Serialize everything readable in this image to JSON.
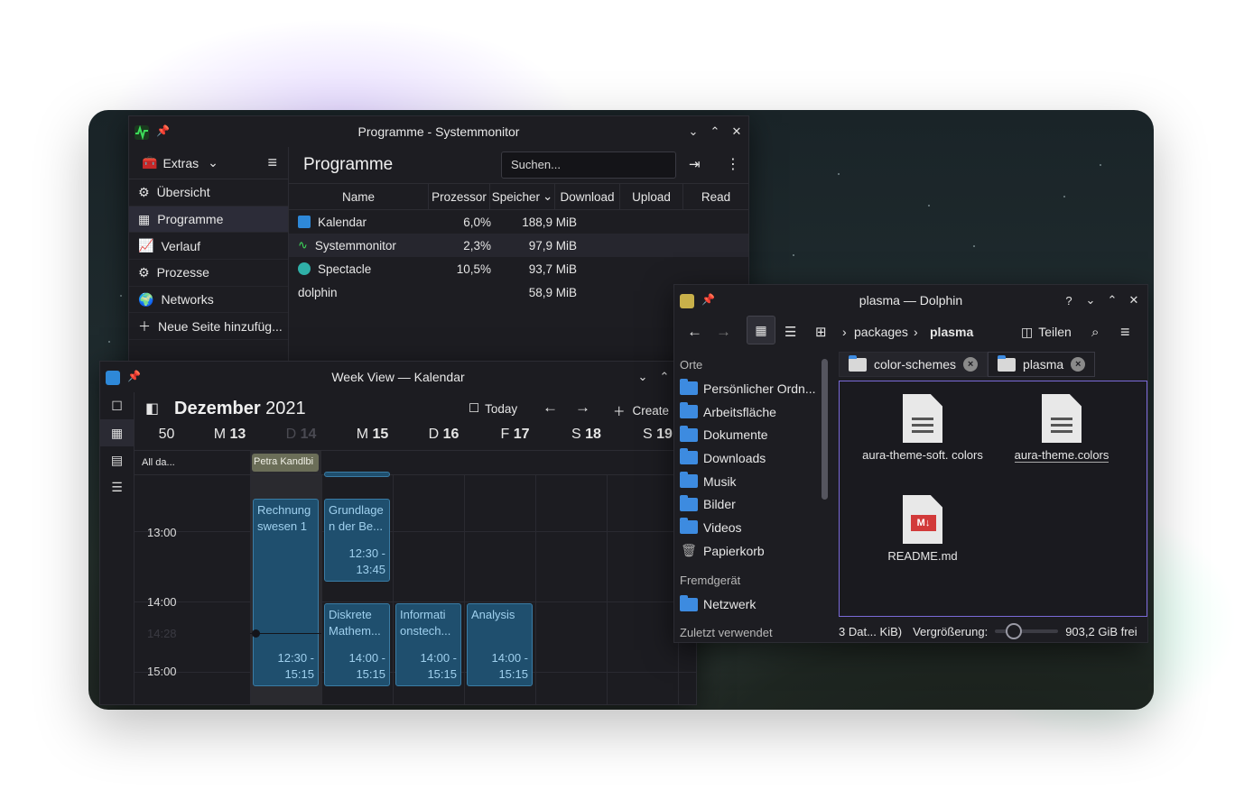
{
  "sysmon": {
    "title": "Programme - Systemmonitor",
    "extras_label": "Extras",
    "sidebar": [
      {
        "label": "Übersicht",
        "icon": "overview-icon"
      },
      {
        "label": "Programme",
        "icon": "apps-grid-icon",
        "active": true
      },
      {
        "label": "Verlauf",
        "icon": "history-chart-icon"
      },
      {
        "label": "Prozesse",
        "icon": "processes-icon"
      },
      {
        "label": "Networks",
        "icon": "globe-icon"
      },
      {
        "label": "Neue Seite hinzufüg...",
        "icon": "plus-icon"
      }
    ],
    "page_title": "Programme",
    "search_placeholder": "Suchen...",
    "columns": [
      "Name",
      "Prozessor",
      "Speicher",
      "Download",
      "Upload",
      "Read"
    ],
    "rows": [
      {
        "name": "Kalendar",
        "cpu": "6,0%",
        "mem": "188,9 MiB"
      },
      {
        "name": "Systemmonitor",
        "cpu": "2,3%",
        "mem": "97,9 MiB"
      },
      {
        "name": "Spectacle",
        "cpu": "10,5%",
        "mem": "93,7 MiB"
      },
      {
        "name": "dolphin",
        "cpu": "",
        "mem": "58,9 MiB"
      }
    ]
  },
  "kalendar": {
    "title": "Week View — Kalendar",
    "month": "Dezember",
    "year": "2021",
    "today_label": "Today",
    "create_label": "Create",
    "week_label": "50",
    "days": [
      {
        "wd": "M",
        "d": "13"
      },
      {
        "wd": "D",
        "d": "14"
      },
      {
        "wd": "M",
        "d": "15"
      },
      {
        "wd": "D",
        "d": "16"
      },
      {
        "wd": "F",
        "d": "17"
      },
      {
        "wd": "S",
        "d": "18"
      },
      {
        "wd": "S",
        "d": "19"
      }
    ],
    "allday_label": "All da...",
    "allday_event": "Petra Kandlbi",
    "times": [
      "13:00",
      "14:00",
      "14:28",
      "15:00"
    ],
    "events": [
      {
        "title": "Rechnung swesen 1",
        "time": "12:30 - 15:15"
      },
      {
        "title": "Grundlage n der Be...",
        "time": "12:30 - 13:45"
      },
      {
        "title": "Diskrete Mathem...",
        "time": "14:00 - 15:15"
      },
      {
        "title": "Informati onstech...",
        "time": "14:00 - 15:15"
      },
      {
        "title": "Analysis",
        "time": "14:00 - 15:15"
      }
    ]
  },
  "dolphin": {
    "title": "plasma — Dolphin",
    "breadcrumb": [
      "packages",
      "plasma"
    ],
    "split_label": "Teilen",
    "places_header": "Orte",
    "places": [
      "Persönlicher Ordn...",
      "Arbeitsfläche",
      "Dokumente",
      "Downloads",
      "Musik",
      "Bilder",
      "Videos",
      "Papierkorb"
    ],
    "devices_header": "Fremdgerät",
    "network": "Netzwerk",
    "recent_header": "Zuletzt verwendet",
    "tabs": [
      "color-schemes",
      "plasma"
    ],
    "files": [
      {
        "name": "aura-theme-soft. colors",
        "icon": "text-file-icon"
      },
      {
        "name": "aura-theme.colors",
        "icon": "text-file-icon"
      },
      {
        "name": "README.md",
        "icon": "markdown-file-icon"
      }
    ],
    "status": "3 Dat... KiB)",
    "zoom_label": "Vergrößerung:",
    "free_space": "903,2 GiB frei"
  }
}
